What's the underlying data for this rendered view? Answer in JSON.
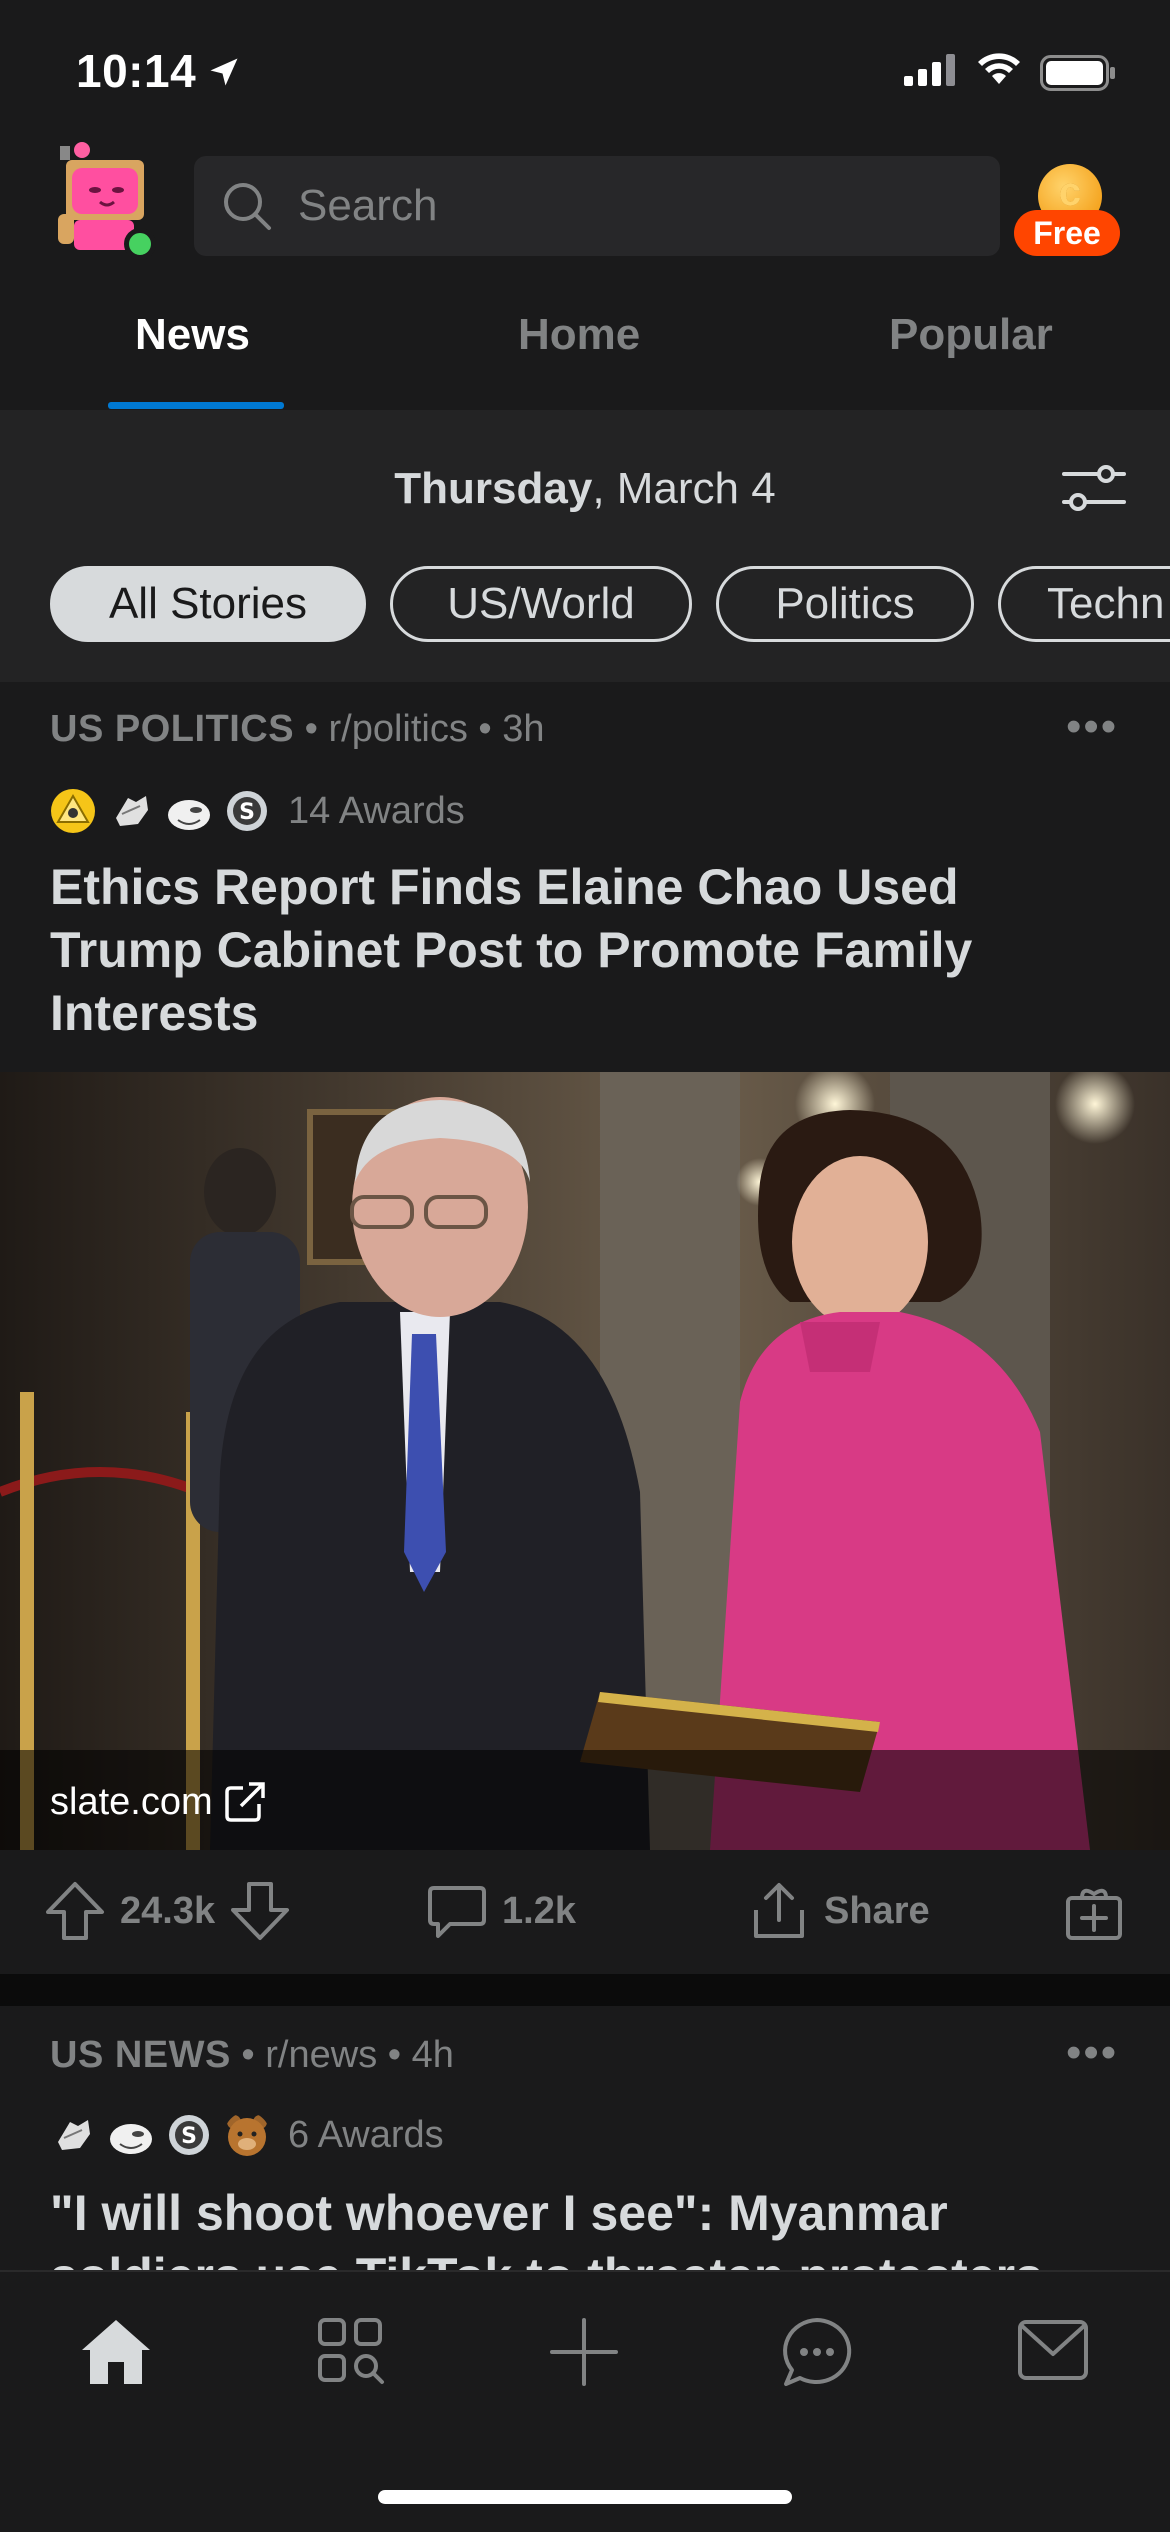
{
  "status_bar": {
    "time": "10:14"
  },
  "header": {
    "search_placeholder": "Search",
    "coin_badge": "Free"
  },
  "tabs": [
    {
      "label": "News",
      "active": true
    },
    {
      "label": "Home",
      "active": false
    },
    {
      "label": "Popular",
      "active": false
    }
  ],
  "news": {
    "date_day": "Thursday",
    "date_rest": ", March 4",
    "filters": [
      "All Stories",
      "US/World",
      "Politics",
      "Techn"
    ]
  },
  "posts": [
    {
      "category": "US POLITICS",
      "subreddit": "r/politics",
      "age": "3h",
      "awards_text": "14 Awards",
      "title": "Ethics Report Finds Elaine Chao Used Trump Cabinet Post to Promote Family Interests",
      "link_domain": "slate.com",
      "upvotes": "24.3k",
      "comments": "1.2k",
      "share_label": "Share"
    },
    {
      "category": "US NEWS",
      "subreddit": "r/news",
      "age": "4h",
      "awards_text": "6 Awards",
      "title": "\"I will shoot whoever I see\": Myanmar soldiers use TikTok to threaten protesters"
    }
  ],
  "colors": {
    "background": "#1a1a1b",
    "accent": "#0079d3",
    "coin_badge": "#ff4500",
    "online": "#46d160"
  }
}
